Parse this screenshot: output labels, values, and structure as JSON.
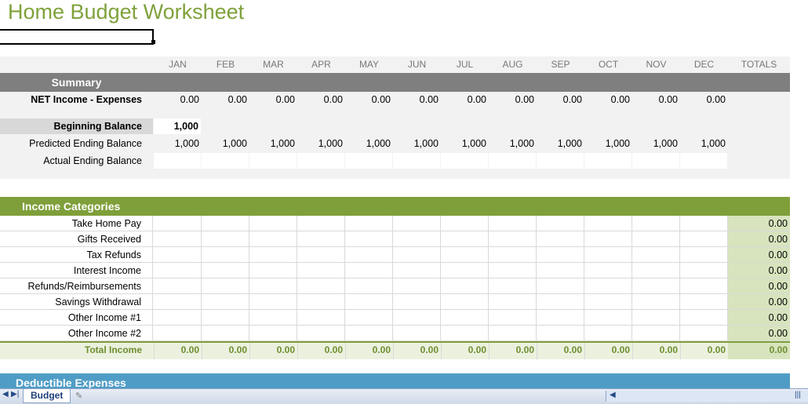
{
  "title": "Home Budget Worksheet",
  "months": [
    "JAN",
    "FEB",
    "MAR",
    "APR",
    "MAY",
    "JUN",
    "JUL",
    "AUG",
    "SEP",
    "OCT",
    "NOV",
    "DEC"
  ],
  "totals_header": "TOTALS",
  "summary": {
    "label": "Summary",
    "net_label": "NET Income - Expenses",
    "net_values": [
      "0.00",
      "0.00",
      "0.00",
      "0.00",
      "0.00",
      "0.00",
      "0.00",
      "0.00",
      "0.00",
      "0.00",
      "0.00",
      "0.00"
    ],
    "beginning_label": "Beginning Balance",
    "beginning_value": "1,000",
    "predicted_label": "Predicted Ending Balance",
    "predicted_values": [
      "1,000",
      "1,000",
      "1,000",
      "1,000",
      "1,000",
      "1,000",
      "1,000",
      "1,000",
      "1,000",
      "1,000",
      "1,000",
      "1,000"
    ],
    "actual_label": "Actual Ending Balance"
  },
  "income": {
    "label": "Income Categories",
    "rows": [
      {
        "label": "Take Home Pay",
        "total": "0.00"
      },
      {
        "label": "Gifts Received",
        "total": "0.00"
      },
      {
        "label": "Tax Refunds",
        "total": "0.00"
      },
      {
        "label": "Interest Income",
        "total": "0.00"
      },
      {
        "label": "Refunds/Reimbursements",
        "total": "0.00"
      },
      {
        "label": "Savings Withdrawal",
        "total": "0.00"
      },
      {
        "label": "Other Income #1",
        "total": "0.00"
      },
      {
        "label": "Other Income #2",
        "total": "0.00"
      }
    ],
    "total_label": "Total Income",
    "total_values": [
      "0.00",
      "0.00",
      "0.00",
      "0.00",
      "0.00",
      "0.00",
      "0.00",
      "0.00",
      "0.00",
      "0.00",
      "0.00",
      "0.00"
    ],
    "grand_total": "0.00"
  },
  "deductible": {
    "label": "Deductible Expenses"
  },
  "sheet_tab": "Budget",
  "colors": {
    "accent_green": "#7f9f3a",
    "summary_gray": "#7f7f7f",
    "deductible_blue": "#4f9dc6"
  }
}
